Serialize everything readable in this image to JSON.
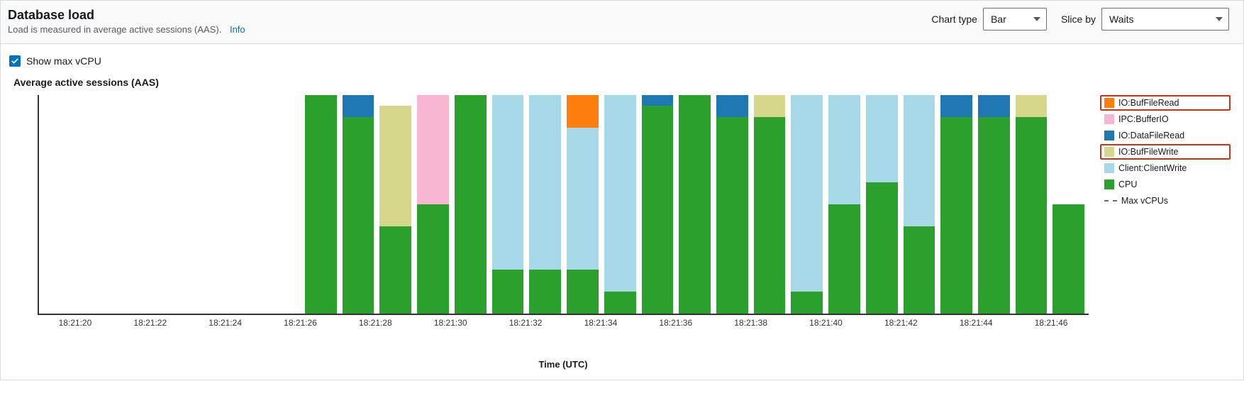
{
  "header": {
    "title": "Database load",
    "subtitle": "Load is measured in average active sessions (AAS).",
    "info_label": "Info",
    "chart_type_label": "Chart type",
    "chart_type_value": "Bar",
    "slice_by_label": "Slice by",
    "slice_by_value": "Waits"
  },
  "options": {
    "show_max_vcpu_label": "Show max vCPU",
    "show_max_vcpu_checked": true
  },
  "chart": {
    "title": "Average active sessions (AAS)",
    "xlabel": "Time (UTC)"
  },
  "legend": {
    "items": [
      {
        "key": "buffileread",
        "label": "IO:BufFileRead",
        "highlight": true
      },
      {
        "key": "bufferio",
        "label": "IPC:BufferIO",
        "highlight": false
      },
      {
        "key": "datafileread",
        "label": "IO:DataFileRead",
        "highlight": false
      },
      {
        "key": "buffilewrite",
        "label": "IO:BufFileWrite",
        "highlight": true
      },
      {
        "key": "clientwrite",
        "label": "Client:ClientWrite",
        "highlight": false
      },
      {
        "key": "cpu",
        "label": "CPU",
        "highlight": false
      }
    ],
    "max_vcpu_label": "Max vCPUs"
  },
  "chart_data": {
    "type": "bar",
    "stacked": true,
    "title": "Average active sessions (AAS)",
    "xlabel": "Time (UTC)",
    "ylabel": "",
    "ylim": [
      0,
      1
    ],
    "x_tick_labels": [
      "18:21:20",
      "18:21:22",
      "18:21:24",
      "18:21:26",
      "18:21:28",
      "18:21:30",
      "18:21:32",
      "18:21:34",
      "18:21:36",
      "18:21:38",
      "18:21:40",
      "18:21:42",
      "18:21:44",
      "18:21:46"
    ],
    "categories_index": [
      0,
      1,
      2,
      3,
      4,
      5,
      6,
      7,
      8,
      9,
      10,
      11,
      12,
      13,
      14,
      15,
      16,
      17,
      18,
      19,
      20,
      21,
      22,
      23,
      24,
      25,
      26,
      27
    ],
    "series_stack_order": [
      "CPU",
      "Client:ClientWrite",
      "IO:BufFileWrite",
      "IO:DataFileRead",
      "IPC:BufferIO",
      "IO:BufFileRead"
    ],
    "series": [
      {
        "name": "CPU",
        "values": [
          0,
          0,
          0,
          0,
          0,
          0,
          0,
          1.0,
          0.9,
          0.4,
          0.5,
          1.0,
          0.2,
          0.2,
          0.2,
          0.1,
          0.95,
          1.0,
          0.9,
          0.9,
          0.1,
          0.5,
          0.6,
          0.4,
          0.9,
          0.9,
          0.9,
          0.5
        ]
      },
      {
        "name": "Client:ClientWrite",
        "values": [
          0,
          0,
          0,
          0,
          0,
          0,
          0,
          0,
          0,
          0,
          0,
          0,
          0.8,
          0.8,
          0.65,
          0.9,
          0,
          0,
          0,
          0,
          0.9,
          0.5,
          0.4,
          0.6,
          0,
          0,
          0,
          0
        ]
      },
      {
        "name": "IO:BufFileWrite",
        "values": [
          0,
          0,
          0,
          0,
          0,
          0,
          0,
          0,
          0,
          0.55,
          0,
          0,
          0,
          0,
          0,
          0,
          0,
          0,
          0,
          0.1,
          0,
          0,
          0,
          0,
          0,
          0,
          0.1,
          0
        ]
      },
      {
        "name": "IO:DataFileRead",
        "values": [
          0,
          0,
          0,
          0,
          0,
          0,
          0,
          0,
          0.1,
          0,
          0,
          0,
          0,
          0,
          0,
          0,
          0.05,
          0,
          0.1,
          0,
          0,
          0,
          0,
          0,
          0.1,
          0.1,
          0,
          0
        ]
      },
      {
        "name": "IPC:BufferIO",
        "values": [
          0,
          0,
          0,
          0,
          0,
          0,
          0,
          0,
          0,
          0,
          0.5,
          0,
          0,
          0,
          0,
          0,
          0,
          0,
          0,
          0,
          0,
          0,
          0,
          0,
          0,
          0,
          0,
          0
        ]
      },
      {
        "name": "IO:BufFileRead",
        "values": [
          0,
          0,
          0,
          0,
          0,
          0,
          0,
          0,
          0,
          0,
          0,
          0,
          0,
          0,
          0.15,
          0,
          0,
          0,
          0,
          0,
          0,
          0,
          0,
          0,
          0,
          0,
          0,
          0
        ]
      }
    ]
  }
}
